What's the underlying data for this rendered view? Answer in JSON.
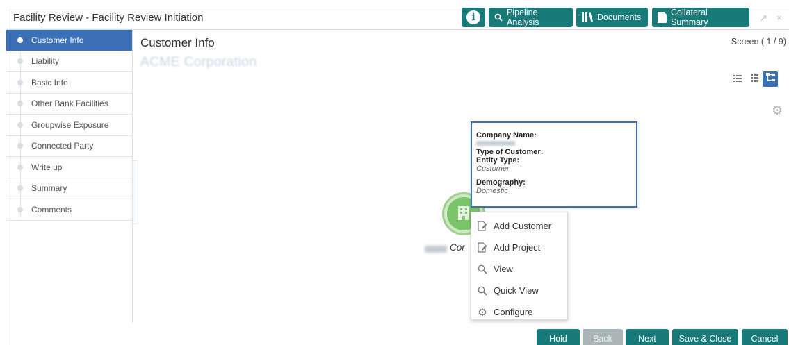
{
  "header": {
    "title": "Facility Review - Facility Review Initiation",
    "buttons": {
      "pipeline": "Pipeline Analysis",
      "documents": "Documents",
      "collateral": "Collateral Summary"
    },
    "info_glyph": "i",
    "minimize_glyph": "↗",
    "close_glyph": "×"
  },
  "sidebar": {
    "items": [
      {
        "label": "Customer Info",
        "active": true
      },
      {
        "label": "Liability"
      },
      {
        "label": "Basic Info"
      },
      {
        "label": "Other Bank Facilities"
      },
      {
        "label": "Groupwise Exposure"
      },
      {
        "label": "Connected Party"
      },
      {
        "label": "Write up"
      },
      {
        "label": "Summary"
      },
      {
        "label": "Comments"
      }
    ]
  },
  "main": {
    "title": "Customer Info",
    "company_name": "ACME Corporation",
    "screen_count": "Screen ( 1 / 9)"
  },
  "node": {
    "label": "Cor"
  },
  "tooltip": {
    "company_name_label": "Company Name:",
    "type_label": "Type of Customer:",
    "entity_label": "Entity Type:",
    "entity_value": "Customer",
    "demography_label": "Demography:",
    "demography_value": "Domestic"
  },
  "context_menu": {
    "items": [
      {
        "label": "Add Customer",
        "icon": "edit-icon"
      },
      {
        "label": "Add Project",
        "icon": "edit-icon"
      },
      {
        "label": "View",
        "icon": "search-icon"
      },
      {
        "label": "Quick View",
        "icon": "search-icon"
      },
      {
        "label": "Configure",
        "icon": "gear-icon"
      }
    ]
  },
  "footer": {
    "hold": "Hold",
    "back": "Back",
    "next": "Next",
    "save_close": "Save & Close",
    "cancel": "Cancel"
  },
  "colors": {
    "accent": "#197a7a",
    "active_blue": "#3b6fb6",
    "node_green": "#7cc46a"
  }
}
